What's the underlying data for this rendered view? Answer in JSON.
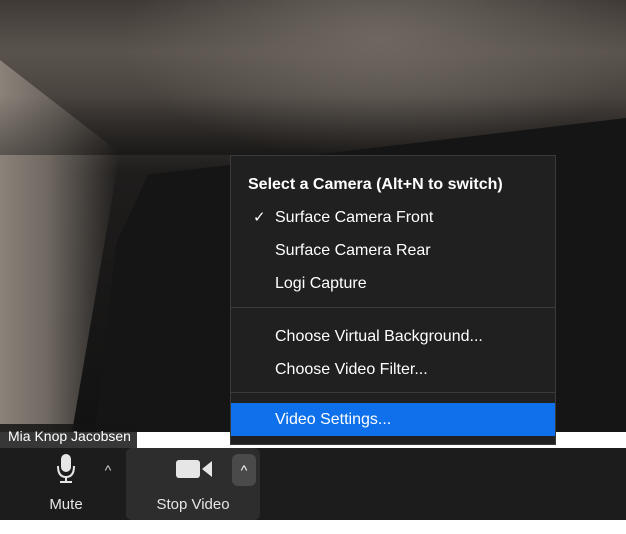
{
  "participant": {
    "name": "Mia Knop Jacobsen"
  },
  "camera_menu": {
    "title": "Select a Camera (Alt+N to switch)",
    "cameras": [
      {
        "label": "Surface Camera Front",
        "selected": true
      },
      {
        "label": "Surface Camera Rear",
        "selected": false
      },
      {
        "label": "Logi Capture",
        "selected": false
      }
    ],
    "options": [
      {
        "label": "Choose Virtual Background..."
      },
      {
        "label": "Choose Video Filter..."
      }
    ],
    "settings_label": "Video Settings...",
    "check_mark": "✓",
    "highlight_color": "#0e71eb"
  },
  "toolbar": {
    "mute_label": "Mute",
    "stop_video_label": "Stop Video",
    "caret_glyph": "^",
    "icons": {
      "mute": "microphone-icon",
      "video": "video-camera-icon",
      "caret": "chevron-up-icon"
    }
  }
}
